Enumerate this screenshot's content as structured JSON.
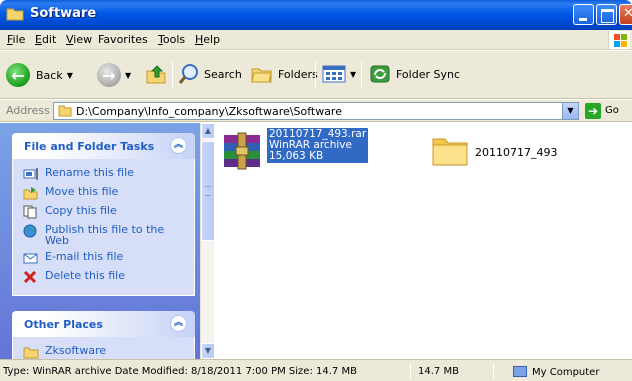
{
  "window": {
    "title": "Software"
  },
  "menu": [
    {
      "label": "File",
      "u": "F",
      "rest": "ile"
    },
    {
      "label": "Edit",
      "u": "E",
      "rest": "dit"
    },
    {
      "label": "View",
      "u": "V",
      "rest": "iew"
    },
    {
      "label": "Favorites",
      "u": "",
      "rest": "Favorites"
    },
    {
      "label": "Tools",
      "u": "T",
      "rest": "ools"
    },
    {
      "label": "Help",
      "u": "H",
      "rest": "elp"
    }
  ],
  "toolbar": {
    "back": "Back",
    "search": "Search",
    "folders": "Folders",
    "folder_sync": "Folder Sync"
  },
  "address": {
    "label": "Address",
    "path": "D:\\Company\\Info_company\\Zksoftware\\Software",
    "go": "Go"
  },
  "tasks_panel": {
    "title": "File and Folder Tasks",
    "items": [
      {
        "label": "Rename this file",
        "icon": "rename-icon"
      },
      {
        "label": "Move this file",
        "icon": "move-icon"
      },
      {
        "label": "Copy this file",
        "icon": "copy-icon"
      },
      {
        "label": "Publish this file to the Web",
        "icon": "publish-web-icon"
      },
      {
        "label": "E-mail this file",
        "icon": "email-icon"
      },
      {
        "label": "Delete this file",
        "icon": "delete-icon"
      }
    ]
  },
  "places_panel": {
    "title": "Other Places",
    "items": [
      {
        "label": "Zksoftware",
        "icon": "folder-icon"
      }
    ]
  },
  "files": [
    {
      "name": "20110717_493.rar",
      "type": "WinRAR archive",
      "size": "15,063 KB",
      "icon": "winrar-archive-icon",
      "selected": true
    },
    {
      "name": "20110717_493",
      "icon": "folder-icon",
      "selected": false
    }
  ],
  "status": {
    "main": "Type: WinRAR archive Date Modified: 8/18/2011 7:00 PM Size: 14.7 MB",
    "size": "14.7 MB",
    "location": "My Computer"
  },
  "colors": {
    "titlebar": "#0058e6",
    "task_link": "#215dc6",
    "selection": "#316ac5"
  }
}
